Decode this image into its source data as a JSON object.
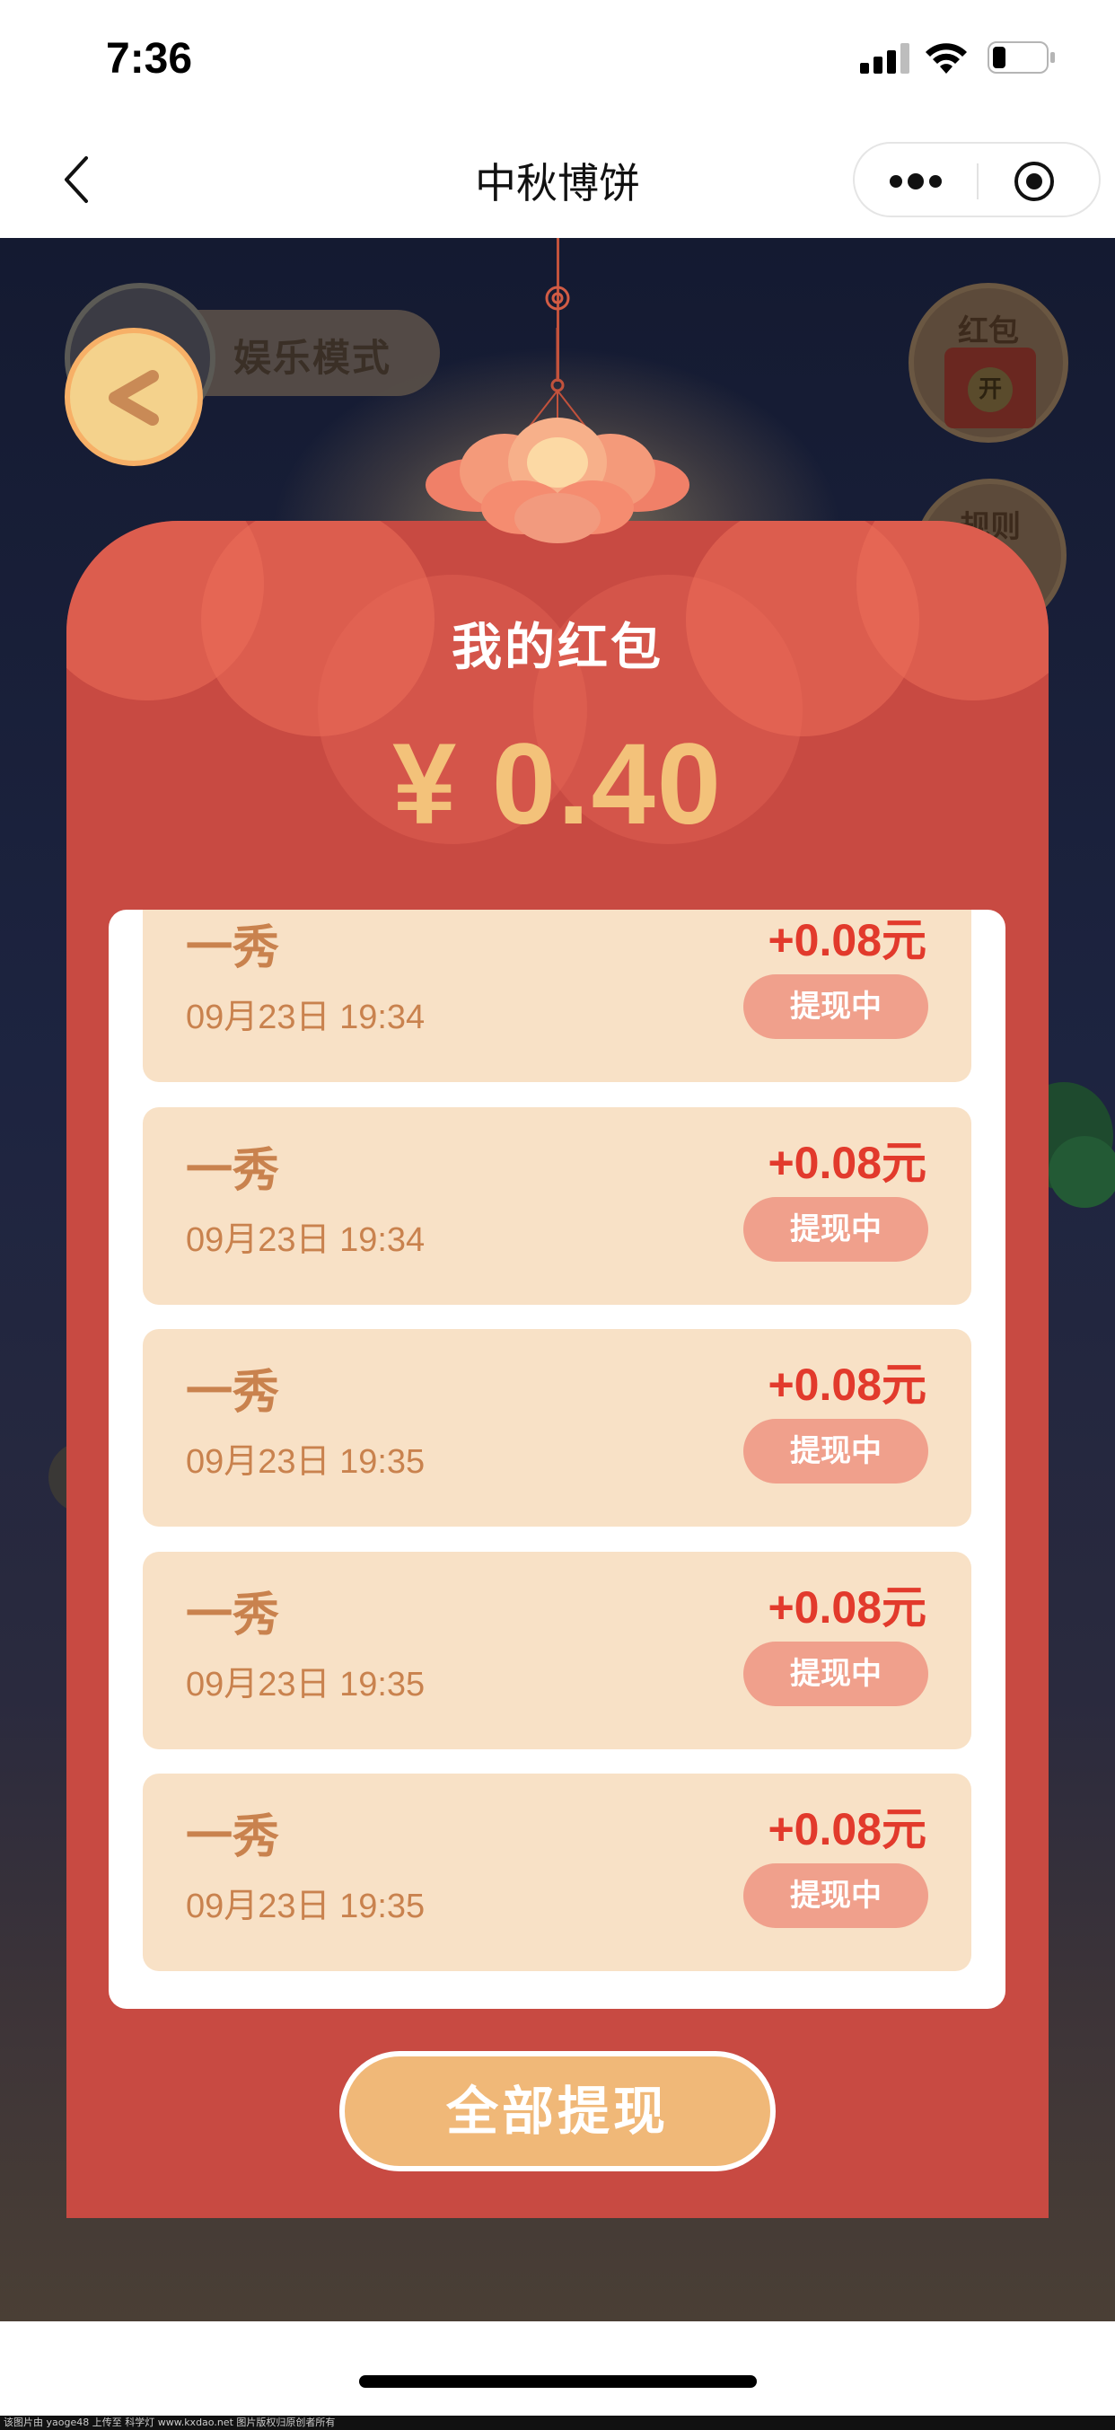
{
  "status_bar": {
    "time": "7:36"
  },
  "nav": {
    "title": "中秋博饼"
  },
  "game": {
    "mode_label": "娱乐模式",
    "hongbao_button_label": "红包",
    "hongbao_open_label": "开",
    "rules_button_label": "规则"
  },
  "card": {
    "title": "我的红包",
    "total_amount": "¥ 0.40",
    "records": [
      {
        "name": "一秀",
        "time": "09月23日 19:34",
        "amount": "+0.08元",
        "status": "提现中"
      },
      {
        "name": "一秀",
        "time": "09月23日 19:34",
        "amount": "+0.08元",
        "status": "提现中"
      },
      {
        "name": "一秀",
        "time": "09月23日 19:35",
        "amount": "+0.08元",
        "status": "提现中"
      },
      {
        "name": "一秀",
        "time": "09月23日 19:35",
        "amount": "+0.08元",
        "status": "提现中"
      },
      {
        "name": "一秀",
        "time": "09月23日 19:35",
        "amount": "+0.08元",
        "status": "提现中"
      }
    ],
    "withdraw_all_label": "全部提现"
  },
  "footer": {
    "watermark": "该图片由 yaoge48 上传至 科学灯 www.kxdao.net 图片版权归原创者所有"
  },
  "colors": {
    "card_red": "#c84a42",
    "amount_gold": "#f3c27a",
    "record_bg": "#f8e1c6",
    "record_amount_red": "#e23a2c",
    "status_pill": "#f0a08c",
    "withdraw_button": "#f0b878"
  }
}
